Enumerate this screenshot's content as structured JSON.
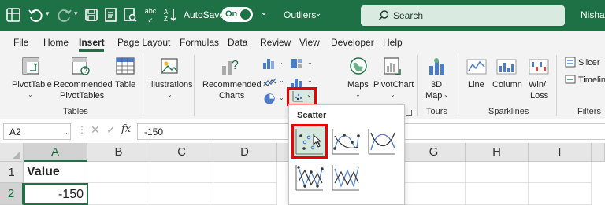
{
  "titlebar": {
    "autosave_label": "AutoSave",
    "autosave_state": "On",
    "filename": "Outliers",
    "search_placeholder": "Search",
    "username": "Nisha C"
  },
  "menu": {
    "items": [
      "File",
      "Home",
      "Insert",
      "Page Layout",
      "Formulas",
      "Data",
      "Review",
      "View",
      "Developer",
      "Help"
    ],
    "active": "Insert"
  },
  "ribbon": {
    "pivottable": "PivotTable",
    "recommended_pivottables_1": "Recommended",
    "recommended_pivottables_2": "PivotTables",
    "table": "Table",
    "tables_group": "Tables",
    "illustrations": "Illustrations",
    "recommended_charts_1": "Recommended",
    "recommended_charts_2": "Charts",
    "maps": "Maps",
    "pivotchart": "PivotChart",
    "map3d_1": "3D",
    "map3d_2": "Map",
    "tours_group": "Tours",
    "line": "Line",
    "column": "Column",
    "winloss_1": "Win/",
    "winloss_2": "Loss",
    "sparklines_group": "Sparklines",
    "slicer": "Slicer",
    "timeline": "Timeline",
    "filters_group": "Filters"
  },
  "formula_bar": {
    "name_box": "A2",
    "fx": "fx",
    "value": "-150"
  },
  "grid": {
    "columns": [
      "A",
      "B",
      "C",
      "D",
      "E",
      "F",
      "G",
      "H",
      "I"
    ],
    "rows": [
      "1",
      "2"
    ],
    "cells": {
      "A1": "Value",
      "A2": "-150"
    }
  },
  "scatter_menu": {
    "title": "Scatter"
  },
  "colors": {
    "excel_green": "#1e7145",
    "highlight_red": "#e00000"
  }
}
